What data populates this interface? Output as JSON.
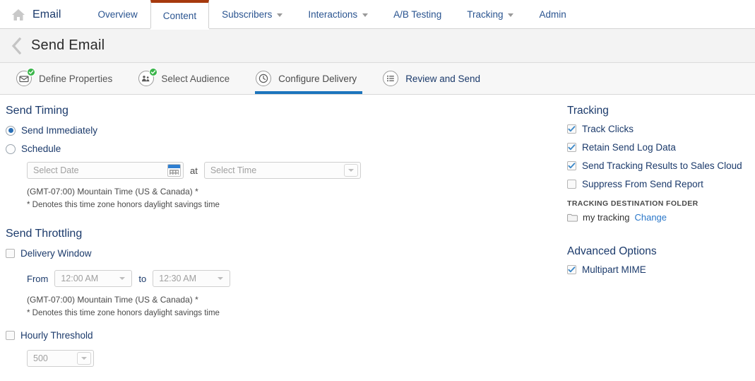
{
  "topnav": {
    "home_icon": "home-icon",
    "brand": "Email",
    "items": [
      {
        "label": "Overview",
        "has_caret": false,
        "active": false
      },
      {
        "label": "Content",
        "has_caret": false,
        "active": true
      },
      {
        "label": "Subscribers",
        "has_caret": true,
        "active": false
      },
      {
        "label": "Interactions",
        "has_caret": true,
        "active": false
      },
      {
        "label": "A/B Testing",
        "has_caret": false,
        "active": false
      },
      {
        "label": "Tracking",
        "has_caret": true,
        "active": false
      },
      {
        "label": "Admin",
        "has_caret": false,
        "active": false
      }
    ]
  },
  "page": {
    "back_icon": "chevron-left-icon",
    "title": "Send Email"
  },
  "wizard": {
    "steps": [
      {
        "label": "Define Properties",
        "icon": "envelope-icon",
        "state": "complete"
      },
      {
        "label": "Select Audience",
        "icon": "audience-icon",
        "state": "complete"
      },
      {
        "label": "Configure Delivery",
        "icon": "clock-icon",
        "state": "current"
      },
      {
        "label": "Review and Send",
        "icon": "list-icon",
        "state": "future"
      }
    ]
  },
  "send_timing": {
    "title": "Send Timing",
    "send_immediately": {
      "label": "Send Immediately",
      "checked": true
    },
    "schedule": {
      "label": "Schedule",
      "checked": false
    },
    "date_placeholder": "Select Date",
    "at_label": "at",
    "time_placeholder": "Select Time",
    "timezone": "(GMT-07:00) Mountain Time (US & Canada) *",
    "dst_note": "* Denotes this time zone honors daylight savings time"
  },
  "send_throttling": {
    "title": "Send Throttling",
    "delivery_window": {
      "label": "Delivery Window",
      "checked": false
    },
    "from_label": "From",
    "from_value": "12:00 AM",
    "to_label": "to",
    "to_value": "12:30 AM",
    "timezone": "(GMT-07:00) Mountain Time (US & Canada) *",
    "dst_note": "* Denotes this time zone honors daylight savings time",
    "hourly_threshold": {
      "label": "Hourly Threshold",
      "checked": false
    },
    "threshold_value": "500"
  },
  "tracking": {
    "title": "Tracking",
    "options": [
      {
        "label": "Track Clicks",
        "checked": true
      },
      {
        "label": "Retain Send Log Data",
        "checked": true
      },
      {
        "label": "Send Tracking Results to Sales Cloud",
        "checked": true
      },
      {
        "label": "Suppress From Send Report",
        "checked": false
      }
    ],
    "folder_heading": "TRACKING DESTINATION FOLDER",
    "folder_name": "my tracking",
    "change_label": "Change"
  },
  "advanced_options": {
    "title": "Advanced Options",
    "options": [
      {
        "label": "Multipart MIME",
        "checked": true
      }
    ]
  },
  "colors": {
    "active_tab_accent": "#a6390d",
    "wizard_active_underline": "#1d75bd",
    "link_blue": "#2a77c9",
    "heading_navy": "#1b3a6b",
    "check_green": "#3ab54a"
  }
}
